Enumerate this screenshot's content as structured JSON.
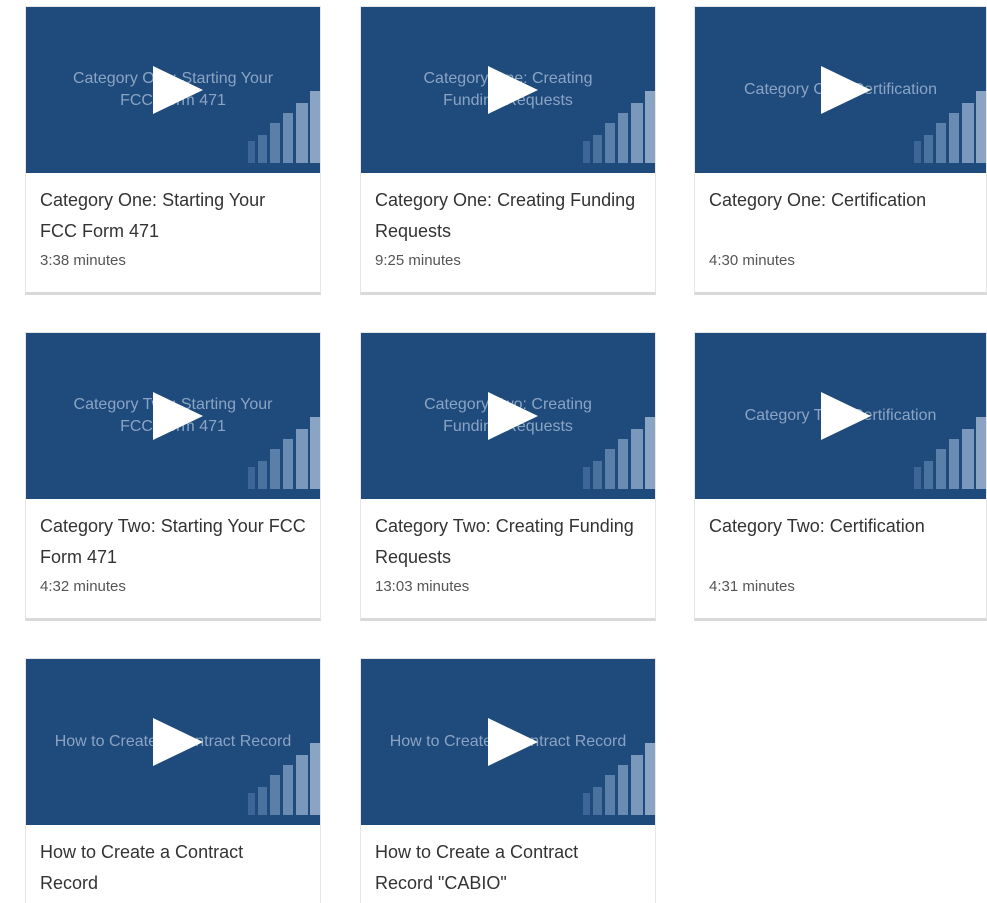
{
  "colors": {
    "thumbnail_bg": "#1f4a7c",
    "thumbnail_text": "#8aa4c4",
    "title_text": "#333333"
  },
  "videos": [
    {
      "thumbnail_text": "Category One: Starting Your\nFCC Form 471",
      "title": "Category One: Starting Your FCC Form 471",
      "duration": "3:38 minutes"
    },
    {
      "thumbnail_text": "Category One: Creating\nFunding Requests",
      "title": "Category One: Creating Funding Requests",
      "duration": "9:25 minutes"
    },
    {
      "thumbnail_text": "Category One: Certification",
      "title": "Category One: Certification",
      "duration": "4:30 minutes"
    },
    {
      "thumbnail_text": "Category Two: Starting Your\nFCC Form 471",
      "title": "Category Two: Starting Your FCC Form 471",
      "duration": "4:32 minutes"
    },
    {
      "thumbnail_text": "Category Two: Creating\nFunding Requests",
      "title": "Category Two: Creating Funding Requests",
      "duration": "13:03 minutes"
    },
    {
      "thumbnail_text": "Category Two: Certification",
      "title": "Category Two: Certification",
      "duration": "4:31 minutes"
    },
    {
      "thumbnail_text": "How to Create a Contract Record",
      "title": "How to Create a Contract Record",
      "duration": ""
    },
    {
      "thumbnail_text": "How to Create a Contract Record",
      "title": "How to Create a Contract Record \"CABIO\"",
      "duration": ""
    }
  ]
}
